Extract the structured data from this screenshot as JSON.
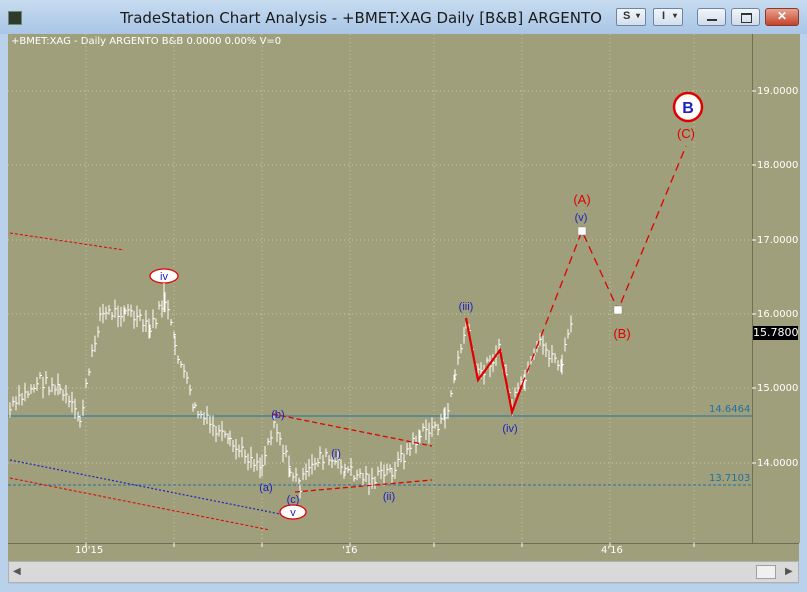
{
  "window": {
    "title": "TradeStation Chart Analysis - +BMET:XAG Daily [B&B] ARGENTO",
    "btn_s": "S",
    "btn_i": "I"
  },
  "chart": {
    "header": "+BMET:XAG - Daily  ARGENTO  B&B  0.0000  0.00%  V=0",
    "y_ticks": [
      "19.0000",
      "18.0000",
      "17.0000",
      "16.0000",
      "15.0000",
      "14.0000"
    ],
    "x_ticks": [
      "10'15",
      "'16",
      "4'16"
    ],
    "last_price": "15.7800",
    "level_upper": "14.6464",
    "level_lower": "13.7103"
  },
  "wave_labels": {
    "iv_top": "iv",
    "v_bottom": "v",
    "a": "(a)",
    "b": "(b)",
    "c": "(c)",
    "i": "(i)",
    "ii": "(ii)",
    "iii": "(iii)",
    "iv": "(iv)",
    "v": "(v)",
    "big_a": "(A)",
    "big_b": "(B)",
    "big_c": "(C)",
    "circle_b": "B"
  },
  "colors": {
    "plot_bg": "#a09f7b",
    "projection": "#e00000",
    "wave_blue": "#2020c0",
    "level_line": "#2070a0"
  }
}
